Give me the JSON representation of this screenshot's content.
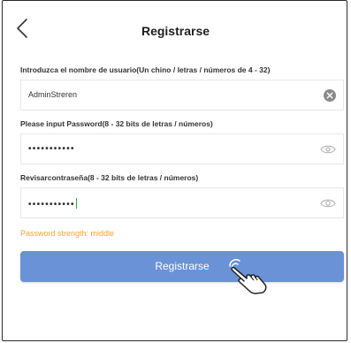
{
  "header": {
    "title": "Registrarse",
    "back_icon": "back-arrow-icon"
  },
  "form": {
    "username": {
      "label": "Introduzca el nombre de usuario(Un chino / letras / números de 4 - 32)",
      "value": "AdminStreren",
      "clear_icon": "clear-icon"
    },
    "password": {
      "label": "Please input Password(8 - 32 bits de letras / números)",
      "masked_value": "•••••••••••",
      "eye_icon": "eye-icon"
    },
    "confirm_password": {
      "label": "Revisarcontraseña(8 - 32 bits de letras / números)",
      "masked_value": "•••••••••••",
      "eye_icon": "eye-icon"
    },
    "strength_text": "Password strength: middle",
    "submit_label": "Registrarse"
  },
  "colors": {
    "accent_button": "#6a92d6",
    "strength_warning": "#f5a623",
    "title_text": "#1e1e1e"
  },
  "overlay": {
    "hand_icon": "pointing-hand-icon"
  }
}
